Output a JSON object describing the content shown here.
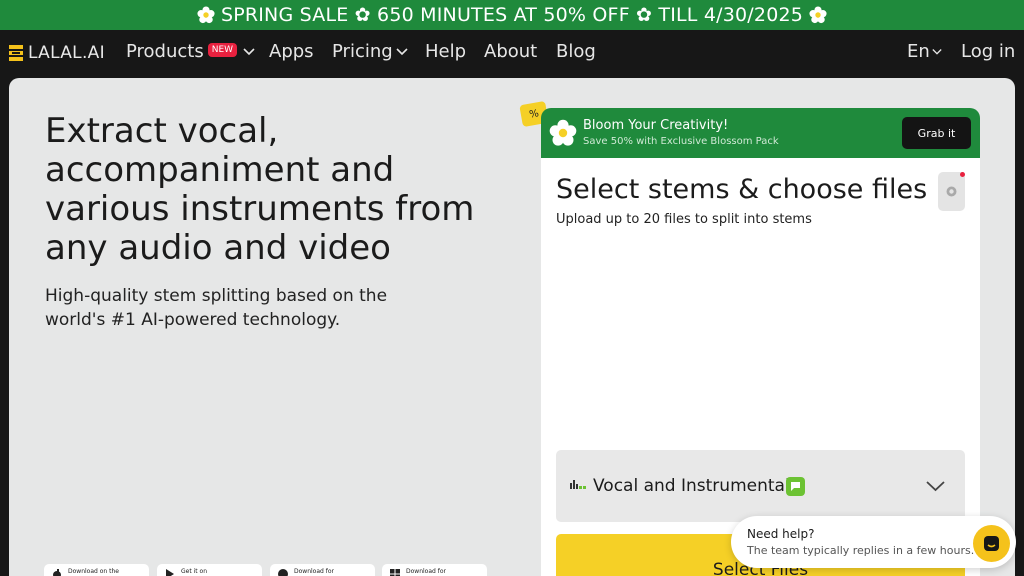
{
  "promo": {
    "text": "SPRING SALE ✿ 650 MINUTES AT 50% OFF ✿ TILL 4/30/2025"
  },
  "nav": {
    "logo": "LALAL.AI",
    "products": "Products",
    "products_badge": "NEW",
    "apps": "Apps",
    "pricing": "Pricing",
    "help": "Help",
    "about": "About",
    "blog": "Blog",
    "language": "En",
    "login": "Log in"
  },
  "hero": {
    "title": "Extract vocal, accompaniment and various instruments from any audio and video",
    "subtitle": "High-quality stem splitting based on the world's #1 AI-powered technology."
  },
  "stores": [
    {
      "label": "Download on the"
    },
    {
      "label": "Get it on"
    },
    {
      "label": "Download for"
    },
    {
      "label": "Download for"
    }
  ],
  "promo_card": {
    "tag": "%",
    "title": "Bloom Your Creativity!",
    "subtitle": "Save 50% with Exclusive Blossom Pack",
    "button": "Grab it"
  },
  "uploader": {
    "title": "Select stems & choose files",
    "subtitle": "Upload up to 20 files to split into stems",
    "stem_option": "Vocal and Instrumental",
    "select_button": "Select Files"
  },
  "help_chat": {
    "title": "Need help?",
    "subtitle": "The team typically replies in a few hours."
  },
  "colors": {
    "green": "#1f8a3c",
    "yellow": "#f5d026",
    "dark": "#171717",
    "panel": "#e6e7e7",
    "red": "#e8213f"
  }
}
